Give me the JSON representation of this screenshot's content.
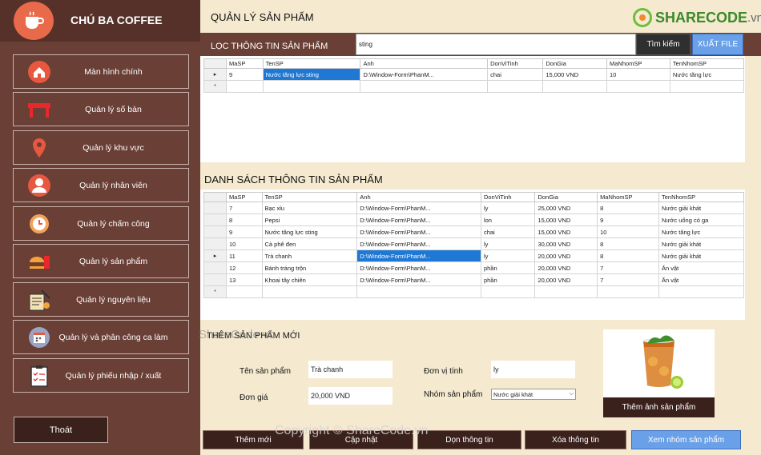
{
  "brand": {
    "name": "CHÚ BA COFFEE",
    "logo_icon": "coffee-cup-icon"
  },
  "menu": [
    {
      "label": "Màn hình chính",
      "icon": "home-icon"
    },
    {
      "label": "Quản lý số bàn",
      "icon": "table-icon"
    },
    {
      "label": "Quản lý khu vực",
      "icon": "location-pin-icon"
    },
    {
      "label": "Quản lý nhân viên",
      "icon": "user-icon"
    },
    {
      "label": "Quản lý chấm công",
      "icon": "clock-icon"
    },
    {
      "label": "Quản lý sản phẩm",
      "icon": "food-icon"
    },
    {
      "label": "Quản lý nguyên liệu",
      "icon": "ingredient-icon"
    },
    {
      "label": "Quản lý và phân công ca làm",
      "icon": "calendar-icon"
    },
    {
      "label": "Quản lý phiếu nhập / xuất",
      "icon": "clipboard-icon"
    }
  ],
  "exit_label": "Thoát",
  "header": {
    "title": "QUẢN LÝ SẢN PHẨM",
    "watermark_brand": "SHARECODE",
    "watermark_ext": ".vn"
  },
  "filter": {
    "label": "LỌC THÔNG TIN SẢN PHẨM",
    "value": "sting",
    "search_label": "Tìm kiếm",
    "export_label": "XUẤT FILE"
  },
  "columns": [
    "MaSP",
    "TenSP",
    "Anh",
    "DonViTinh",
    "DonGia",
    "MaNhomSP",
    "TenNhomSP"
  ],
  "filter_rows": [
    [
      "9",
      "Nước tăng lực sting",
      "D:\\Window-Form\\PhanM...",
      "chai",
      "15,000 VND",
      "10",
      "Nước tăng lực"
    ]
  ],
  "list_title": "DANH SÁCH THÔNG TIN SẢN PHẨM",
  "list_rows": [
    [
      "7",
      "Bạc xỉu",
      "D:\\Window-Form\\PhanM...",
      "ly",
      "25,000 VND",
      "8",
      "Nước giải khát"
    ],
    [
      "8",
      "Pepsi",
      "D:\\Window-Form\\PhanM...",
      "lon",
      "15,000 VND",
      "9",
      "Nước uống có ga"
    ],
    [
      "9",
      "Nước tăng lực sting",
      "D:\\Window-Form\\PhanM...",
      "chai",
      "15,000 VND",
      "10",
      "Nước tăng lực"
    ],
    [
      "10",
      "Cà phê đen",
      "D:\\Window-Form\\PhanM...",
      "ly",
      "30,000 VND",
      "8",
      "Nước giải khát"
    ],
    [
      "11",
      "Trà chanh",
      "D:\\Window-Form\\PhanM...",
      "ly",
      "20,000 VND",
      "8",
      "Nước giải khát"
    ],
    [
      "12",
      "Bánh tráng trộn",
      "D:\\Window-Form\\PhanM...",
      "phần",
      "20,000 VND",
      "7",
      "Ăn vặt"
    ],
    [
      "13",
      "Khoai tây chiên",
      "D:\\Window-Form\\PhanM...",
      "phần",
      "20,000 VND",
      "7",
      "Ăn vặt"
    ]
  ],
  "form": {
    "title": "THÊM SẢN PHẨM MỚI",
    "name_label": "Tên sản phẩm",
    "name_value": "Trà chanh",
    "price_label": "Đơn giá",
    "price_value": "20,000 VND",
    "unit_label": "Đơn vị tính",
    "unit_value": "ly",
    "group_label": "Nhóm sản phẩm",
    "group_value": "Nước giải khát",
    "add_image_label": "Thêm ảnh sản phẩm"
  },
  "actions": {
    "add": "Thêm mới",
    "update": "Cập nhật",
    "clear": "Dọn thông tin",
    "delete": "Xóa thông tin",
    "view_groups": "Xem nhóm sản phẩm"
  },
  "watermarks": {
    "middle": "ShareCode.vn",
    "bottom": "Copyright © ShareCode.vn"
  },
  "colors": {
    "sidebar": "#6a3f36",
    "dark_button": "#3b211c",
    "accent_blue": "#6aa0e8",
    "background": "#f5ead0",
    "selection": "#1f78d4"
  }
}
